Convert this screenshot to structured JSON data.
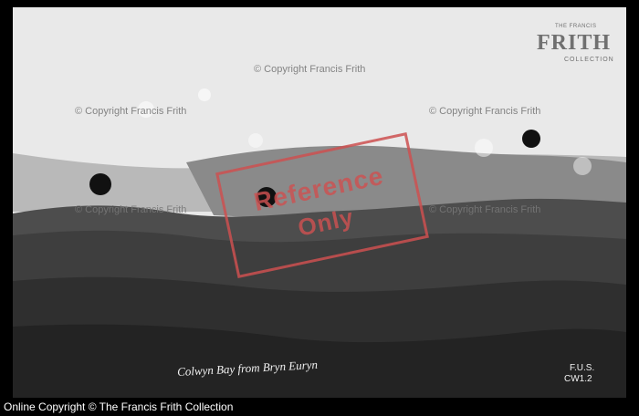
{
  "photo": {
    "caption": "Colwyn Bay from Bryn Euryn",
    "code_line_1": "F.U.S.",
    "code_line_2": "CW1.2"
  },
  "watermarks": {
    "line_1": "© Copyright Francis Frith",
    "line_2": "© Copyright Francis Frith",
    "line_3": "© Copyright Francis Frith",
    "line_4": "© Copyright Francis Frith",
    "line_5": "© Copyright Francis Frith",
    "brand_small": "THE FRANCIS",
    "brand_main": "FRITH",
    "brand_sub": "COLLECTION"
  },
  "stamp": {
    "line_1": "Reference",
    "line_2": "Only"
  },
  "footer": {
    "text": "Online Copyright © The Francis Frith Collection"
  },
  "colors": {
    "stamp": "#cd5050",
    "footer_bg": "#000000",
    "footer_text": "#ffffff"
  }
}
